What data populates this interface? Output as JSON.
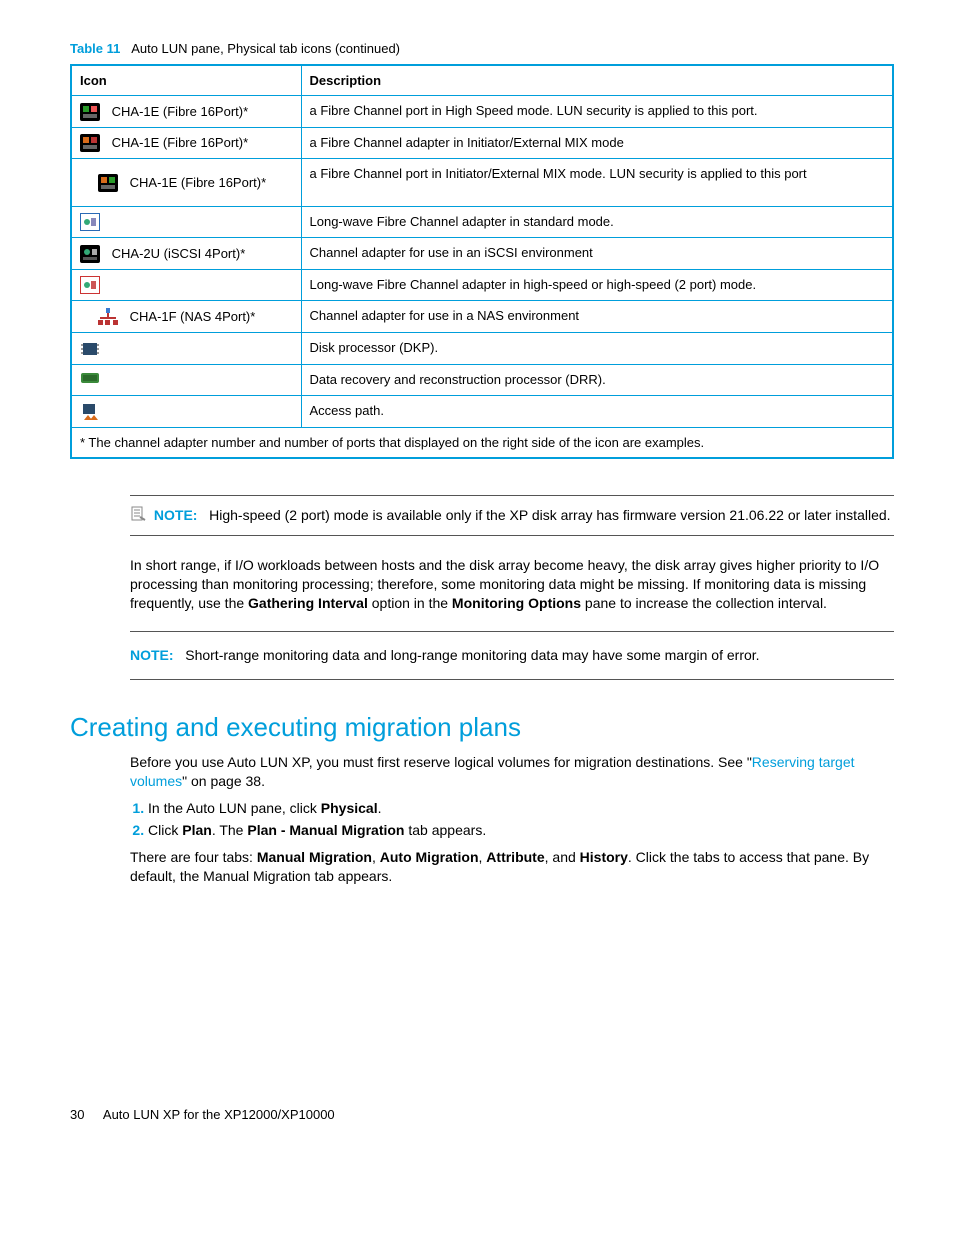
{
  "tableCaption": {
    "label": "Table 11",
    "text": "Auto LUN pane, Physical tab icons (continued)"
  },
  "headers": {
    "icon": "Icon",
    "desc": "Description"
  },
  "rows": [
    {
      "iconLabel": "CHA-1E (Fibre 16Port)*",
      "desc": "a  Fibre Channel port in High Speed mode. LUN security is applied to this port."
    },
    {
      "iconLabel": "CHA-1E (Fibre 16Port)*",
      "desc": "a Fibre Channel adapter in Initiator/External MIX mode"
    },
    {
      "iconLabel": "CHA-1E (Fibre 16Port)*",
      "desc": "a Fibre Channel port in Initiator/External MIX mode. LUN security is applied to this port"
    },
    {
      "iconLabel": "",
      "desc": "Long-wave Fibre Channel adapter in standard mode."
    },
    {
      "iconLabel": "CHA-2U (iSCSI 4Port)*",
      "desc": "Channel adapter for use in an iSCSI environment"
    },
    {
      "iconLabel": "",
      "desc": "Long-wave Fibre Channel adapter in high-speed or high-speed (2 port) mode."
    },
    {
      "iconLabel": "CHA-1F (NAS 4Port)*",
      "desc": "Channel adapter for use in a NAS environment"
    },
    {
      "iconLabel": "",
      "desc": "Disk processor (DKP)."
    },
    {
      "iconLabel": "",
      "desc": "Data recovery and reconstruction processor (DRR)."
    },
    {
      "iconLabel": "",
      "desc": "Access path."
    }
  ],
  "footnote": "* The channel adapter number and number of ports that displayed on the right side of the icon are examples.",
  "note1": {
    "label": "NOTE:",
    "text": "High-speed (2 port) mode is available only if the XP disk array has firmware version 21.06.22 or later installed."
  },
  "para1": {
    "t1": "In short range, if I/O workloads between hosts and the disk array become heavy, the disk array gives higher priority to I/O processing than monitoring processing; therefore, some monitoring data might be missing. If monitoring data is missing frequently, use the ",
    "b1": "Gathering Interval",
    "t2": " option in the ",
    "b2": "Monitoring Options",
    "t3": " pane to increase the collection interval."
  },
  "note2": {
    "label": "NOTE:",
    "text": "Short-range monitoring data and long-range monitoring data may have some margin of error."
  },
  "sectionTitle": "Creating and executing migration plans",
  "secPara": {
    "t1": "Before you use Auto LUN XP, you must first reserve logical volumes for migration destinations. See \"",
    "link": "Reserving target volumes",
    "t2": "\" on page 38."
  },
  "steps": {
    "s1a": "In the Auto LUN pane, click ",
    "s1b": "Physical",
    "s1c": ".",
    "s2a": "Click ",
    "s2b": "Plan",
    "s2c": ". The ",
    "s2d": "Plan - Manual Migration",
    "s2e": " tab appears."
  },
  "tabsPara": {
    "t1": "There are four tabs: ",
    "b1": "Manual Migration",
    "t2": ", ",
    "b2": "Auto Migration",
    "t3": ", ",
    "b3": "Attribute",
    "t4": ", and ",
    "b4": "History",
    "t5": ". Click the tabs to access that pane. By default, the Manual Migration tab appears."
  },
  "footer": {
    "page": "30",
    "title": "Auto LUN XP for the XP12000/XP10000"
  }
}
